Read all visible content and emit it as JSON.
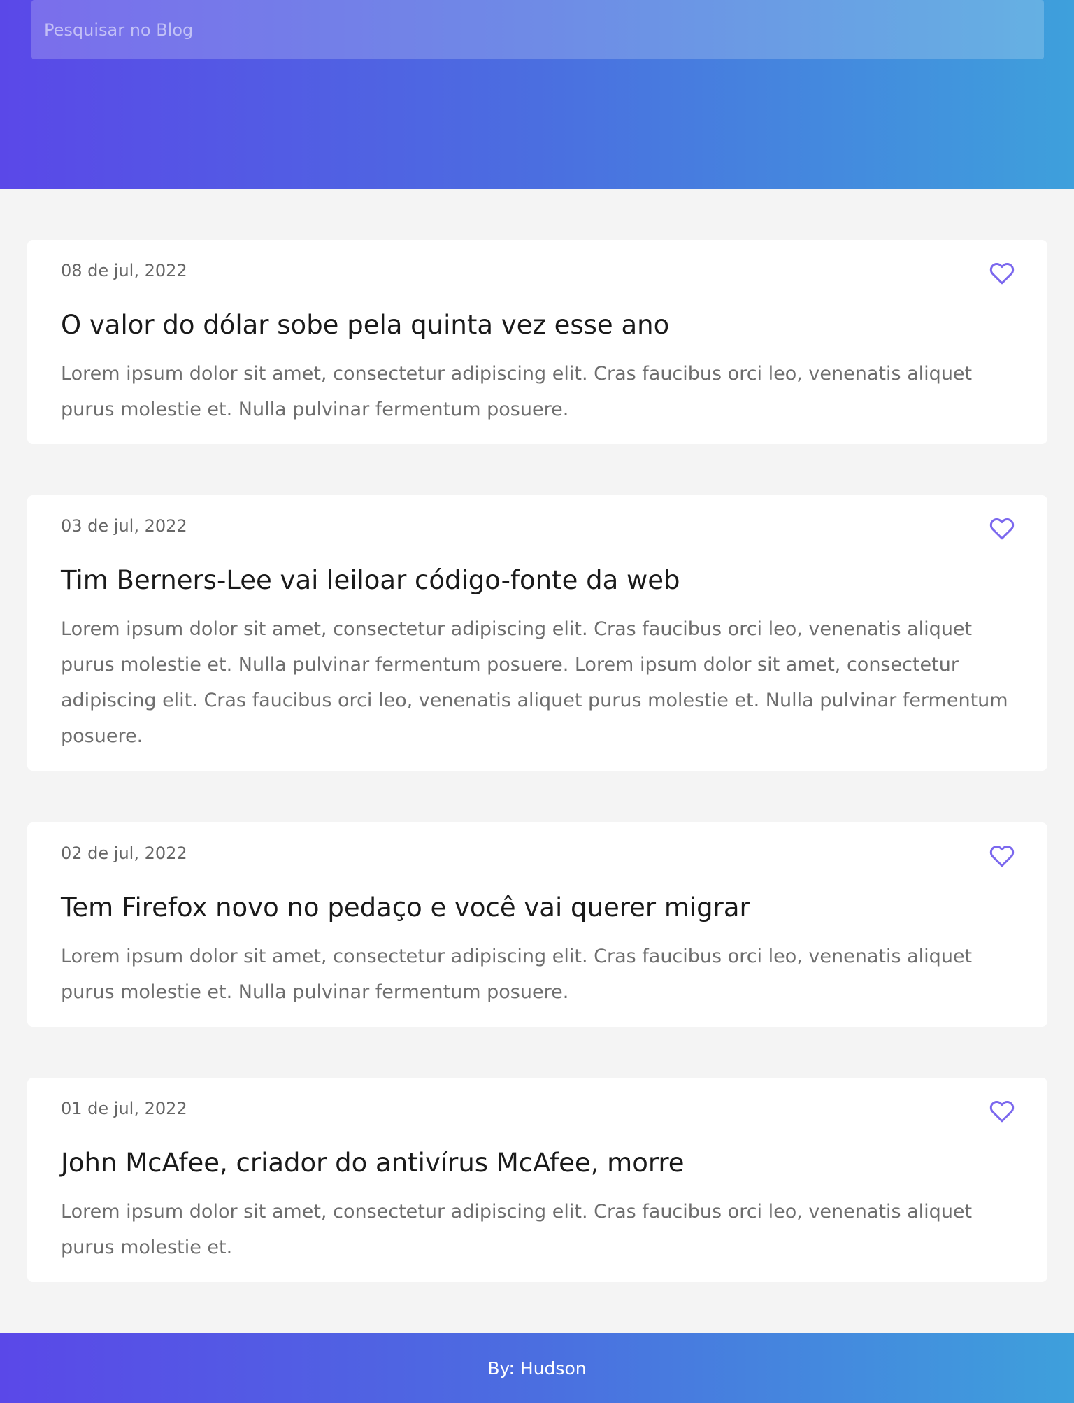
{
  "search": {
    "placeholder": "Pesquisar no Blog"
  },
  "colors": {
    "gradient_start": "#5a48e8",
    "gradient_end": "#3ea0dc",
    "heart": "#7b68ee",
    "background": "#f4f4f4"
  },
  "posts": [
    {
      "date": "08 de jul, 2022",
      "title": "O valor do dólar sobe pela quinta vez esse ano",
      "body": "Lorem ipsum dolor sit amet, consectetur adipiscing elit. Cras faucibus orci leo, venenatis aliquet purus molestie et. Nulla pulvinar fermentum posuere.",
      "icon": "heart-icon"
    },
    {
      "date": "03 de jul, 2022",
      "title": "Tim Berners-Lee vai leiloar código-fonte da web",
      "body": "Lorem ipsum dolor sit amet, consectetur adipiscing elit. Cras faucibus orci leo, venenatis aliquet purus molestie et. Nulla pulvinar fermentum posuere. Lorem ipsum dolor sit amet, consectetur adipiscing elit. Cras faucibus orci leo, venenatis aliquet purus molestie et. Nulla pulvinar fermentum posuere.",
      "icon": "heart-icon"
    },
    {
      "date": "02 de jul, 2022",
      "title": "Tem Firefox novo no pedaço e você vai querer migrar",
      "body": "Lorem ipsum dolor sit amet, consectetur adipiscing elit. Cras faucibus orci leo, venenatis aliquet purus molestie et. Nulla pulvinar fermentum posuere.",
      "icon": "heart-icon"
    },
    {
      "date": "01 de jul, 2022",
      "title": "John McAfee, criador do antivírus McAfee, morre",
      "body": "Lorem ipsum dolor sit amet, consectetur adipiscing elit. Cras faucibus orci leo, venenatis aliquet purus molestie et.",
      "icon": "heart-icon"
    }
  ],
  "footer": {
    "text": "By: Hudson"
  }
}
